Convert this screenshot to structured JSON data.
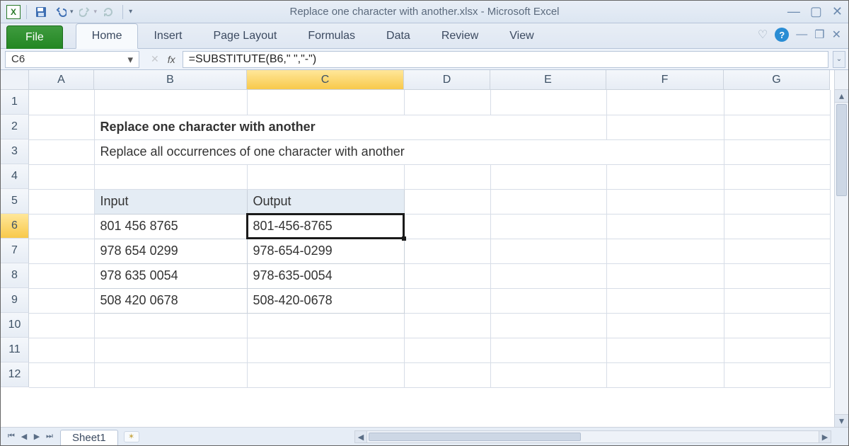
{
  "window": {
    "title": "Replace one character with another.xlsx  -  Microsoft Excel"
  },
  "ribbon": {
    "file": "File",
    "tabs": [
      "Home",
      "Insert",
      "Page Layout",
      "Formulas",
      "Data",
      "Review",
      "View"
    ]
  },
  "formula_bar": {
    "name_box": "C6",
    "fx_label": "fx",
    "formula": "=SUBSTITUTE(B6,\" \",\"-\")"
  },
  "columns": {
    "letters": [
      "A",
      "B",
      "C",
      "D",
      "E",
      "F",
      "G"
    ],
    "widths": [
      92,
      216,
      222,
      122,
      164,
      166,
      150
    ],
    "selected": "C"
  },
  "rows": {
    "visible": [
      1,
      2,
      3,
      4,
      5,
      6,
      7,
      8,
      9,
      10,
      11,
      12
    ],
    "selected": 6
  },
  "content": {
    "title": "Replace one character with another",
    "subtitle": "Replace all occurrences of one character with another",
    "headers": {
      "b": "Input",
      "c": "Output"
    },
    "data": [
      {
        "b": "801 456 8765",
        "c": "801-456-8765"
      },
      {
        "b": "978 654 0299",
        "c": "978-654-0299"
      },
      {
        "b": "978 635 0054",
        "c": "978-635-0054"
      },
      {
        "b": "508 420 0678",
        "c": "508-420-0678"
      }
    ]
  },
  "sheet_tabs": {
    "active": "Sheet1"
  }
}
